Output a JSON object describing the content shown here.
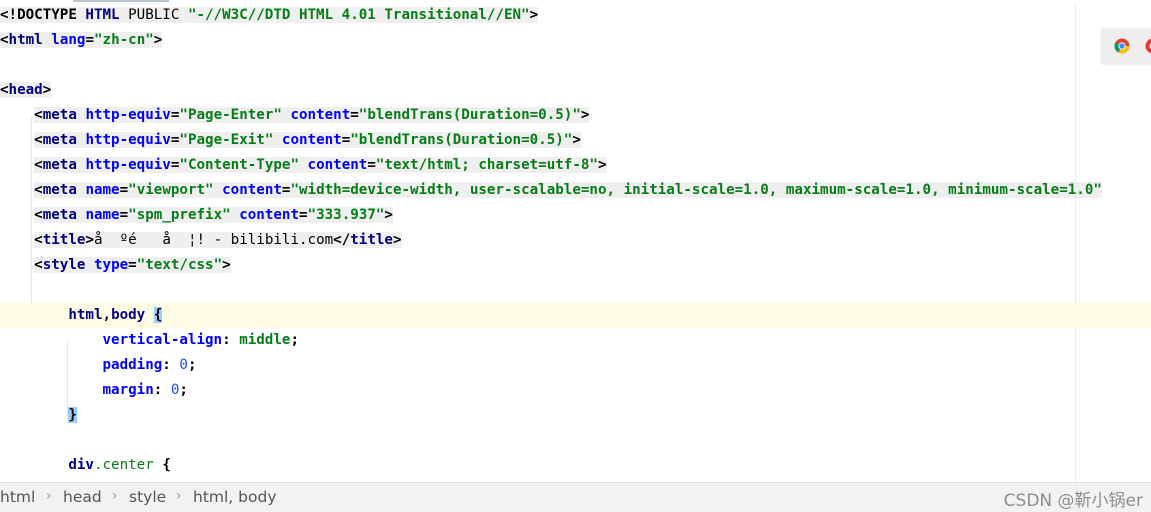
{
  "editor": {
    "lines": [
      {
        "segs": [
          [
            "punct",
            "<!DOCTYPE "
          ],
          [
            "tag",
            "HTML"
          ],
          [
            "plain",
            " PUBLIC "
          ],
          [
            "str",
            "\"-//W3C//DTD HTML 4.01 Transitional//EN\""
          ],
          [
            "punct",
            ">"
          ]
        ]
      },
      {
        "segs": [
          [
            "punct",
            "<"
          ],
          [
            "tag",
            "html"
          ],
          [
            "plain",
            " "
          ],
          [
            "attr",
            "lang"
          ],
          [
            "punct",
            "="
          ],
          [
            "str",
            "\"zh-cn\""
          ],
          [
            "punct",
            ">"
          ]
        ]
      },
      {
        "segs": []
      },
      {
        "segs": [
          [
            "punct",
            "<"
          ],
          [
            "tag",
            "head"
          ],
          [
            "punct",
            ">"
          ]
        ]
      },
      {
        "segs": [
          [
            "plain",
            "    "
          ],
          [
            "punct",
            "<"
          ],
          [
            "tag",
            "meta"
          ],
          [
            "plain",
            " "
          ],
          [
            "attr",
            "http-equiv"
          ],
          [
            "punct",
            "="
          ],
          [
            "str",
            "\"Page-Enter\""
          ],
          [
            "plain",
            " "
          ],
          [
            "attr",
            "content"
          ],
          [
            "punct",
            "="
          ],
          [
            "str",
            "\"blendTrans(Duration=0.5)\""
          ],
          [
            "punct",
            ">"
          ]
        ]
      },
      {
        "segs": [
          [
            "plain",
            "    "
          ],
          [
            "punct",
            "<"
          ],
          [
            "tag",
            "meta"
          ],
          [
            "plain",
            " "
          ],
          [
            "attr",
            "http-equiv"
          ],
          [
            "punct",
            "="
          ],
          [
            "str",
            "\"Page-Exit\""
          ],
          [
            "plain",
            " "
          ],
          [
            "attr",
            "content"
          ],
          [
            "punct",
            "="
          ],
          [
            "str",
            "\"blendTrans(Duration=0.5)\""
          ],
          [
            "punct",
            ">"
          ]
        ]
      },
      {
        "segs": [
          [
            "plain",
            "    "
          ],
          [
            "punct",
            "<"
          ],
          [
            "tag",
            "meta"
          ],
          [
            "plain",
            " "
          ],
          [
            "attr",
            "http-equiv"
          ],
          [
            "punct",
            "="
          ],
          [
            "str",
            "\"Content-Type\""
          ],
          [
            "plain",
            " "
          ],
          [
            "attr",
            "content"
          ],
          [
            "punct",
            "="
          ],
          [
            "str",
            "\"text/html; charset=utf-8\""
          ],
          [
            "punct",
            ">"
          ]
        ]
      },
      {
        "segs": [
          [
            "plain",
            "    "
          ],
          [
            "punct",
            "<"
          ],
          [
            "tag",
            "meta"
          ],
          [
            "plain",
            " "
          ],
          [
            "attr",
            "name"
          ],
          [
            "punct",
            "="
          ],
          [
            "str",
            "\"viewport\""
          ],
          [
            "plain",
            " "
          ],
          [
            "attr",
            "content"
          ],
          [
            "punct",
            "="
          ],
          [
            "str",
            "\"width=device-width, user-scalable=no, initial-scale=1.0, maximum-scale=1.0, minimum-scale=1.0\""
          ]
        ]
      },
      {
        "segs": [
          [
            "plain",
            "    "
          ],
          [
            "punct",
            "<"
          ],
          [
            "tag",
            "meta"
          ],
          [
            "plain",
            " "
          ],
          [
            "attr",
            "name"
          ],
          [
            "punct",
            "="
          ],
          [
            "str",
            "\"spm_prefix\""
          ],
          [
            "plain",
            " "
          ],
          [
            "attr",
            "content"
          ],
          [
            "punct",
            "="
          ],
          [
            "str",
            "\"333.937\""
          ],
          [
            "punct",
            ">"
          ]
        ]
      },
      {
        "segs": [
          [
            "plain",
            "    "
          ],
          [
            "punct",
            "<"
          ],
          [
            "tag",
            "title"
          ],
          [
            "punct",
            ">"
          ],
          [
            "plain",
            "å  ºé   å  ¦! - bilibili.com"
          ],
          [
            "punct",
            "</"
          ],
          [
            "tag",
            "title"
          ],
          [
            "punct",
            ">"
          ]
        ]
      },
      {
        "segs": [
          [
            "plain",
            "    "
          ],
          [
            "punct",
            "<"
          ],
          [
            "tag",
            "style"
          ],
          [
            "plain",
            " "
          ],
          [
            "attr",
            "type"
          ],
          [
            "punct",
            "="
          ],
          [
            "str",
            "\"text/css\""
          ],
          [
            "punct",
            ">"
          ]
        ]
      },
      {
        "segs": []
      },
      {
        "segs": [
          [
            "plain",
            "        "
          ],
          [
            "sel",
            "html"
          ],
          [
            "punct",
            ","
          ],
          [
            "sel",
            "body"
          ],
          [
            "plain",
            " "
          ],
          [
            "bracehl",
            "{"
          ]
        ],
        "current": true
      },
      {
        "segs": [
          [
            "plain",
            "            "
          ],
          [
            "prop",
            "vertical-align"
          ],
          [
            "punct",
            ": "
          ],
          [
            "val",
            "middle"
          ],
          [
            "punct",
            ";"
          ]
        ]
      },
      {
        "segs": [
          [
            "plain",
            "            "
          ],
          [
            "prop",
            "padding"
          ],
          [
            "punct",
            ": "
          ],
          [
            "num",
            "0"
          ],
          [
            "punct",
            ";"
          ]
        ]
      },
      {
        "segs": [
          [
            "plain",
            "            "
          ],
          [
            "prop",
            "margin"
          ],
          [
            "punct",
            ": "
          ],
          [
            "num",
            "0"
          ],
          [
            "punct",
            ";"
          ]
        ]
      },
      {
        "segs": [
          [
            "plain",
            "        "
          ],
          [
            "bracehl",
            "}"
          ]
        ]
      },
      {
        "segs": []
      },
      {
        "segs": [
          [
            "plain",
            "        "
          ],
          [
            "sel",
            "div"
          ],
          [
            "cls",
            ".center"
          ],
          [
            "plain",
            " "
          ],
          [
            "punct",
            "{"
          ]
        ]
      }
    ]
  },
  "breadcrumb": {
    "items": [
      "html",
      "head",
      "style",
      "html, body"
    ],
    "separator": "›"
  },
  "watermark": "CSDN @靳小锅er",
  "icons": {
    "browser_1": "chrome-icon",
    "browser_2": "red-browser-icon"
  },
  "colors": {
    "tag": "#000080",
    "attribute": "#0000ff",
    "string": "#067d17",
    "number": "#1750eb",
    "current_line": "#fffae3",
    "brace_match": "#99ccff"
  }
}
